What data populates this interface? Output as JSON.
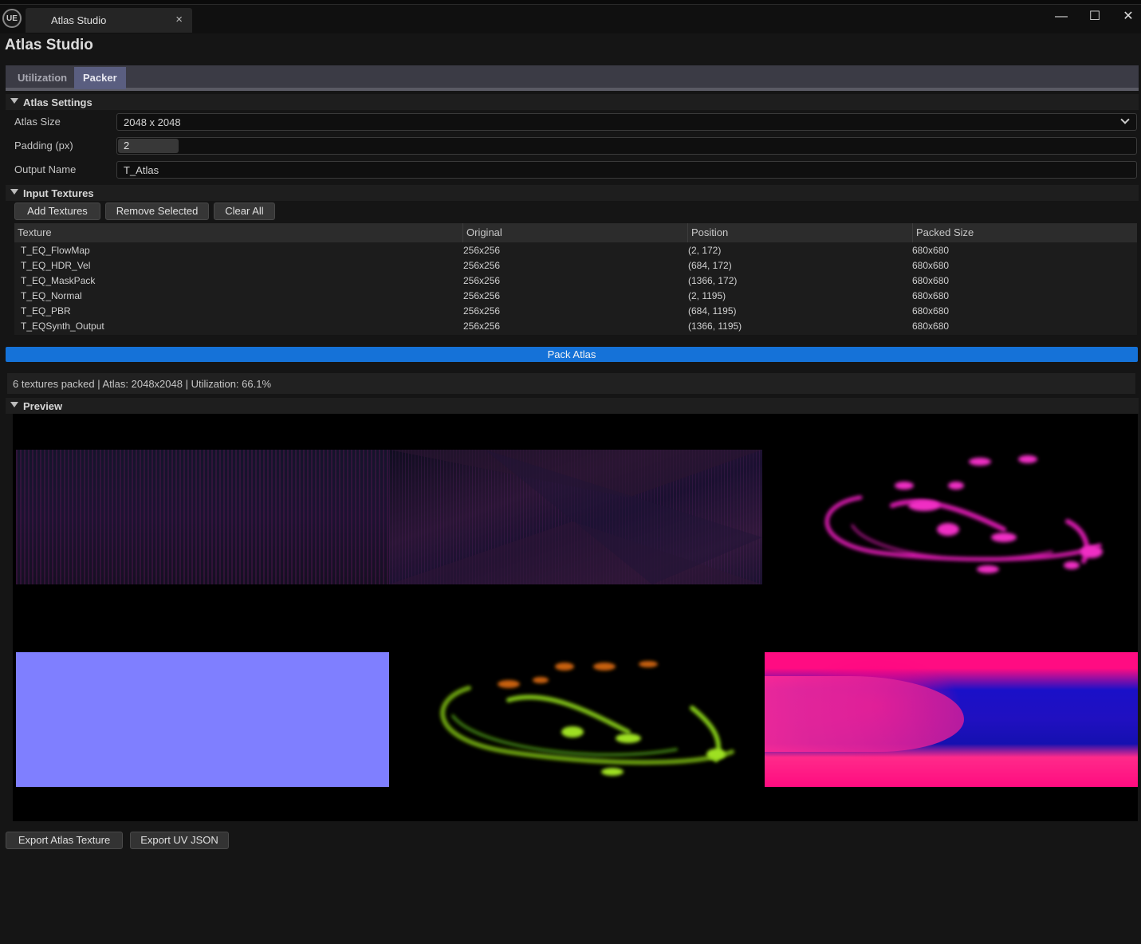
{
  "window": {
    "app_logo": "UE",
    "tab_title": "Atlas Studio",
    "close_tab_glyph": "×",
    "minimize_glyph": "—",
    "maximize_glyph": "☐",
    "close_glyph": "✕"
  },
  "app_title": "Atlas Studio",
  "tabs": [
    {
      "label": "Utilization",
      "active": false
    },
    {
      "label": "Packer",
      "active": true
    }
  ],
  "atlas_settings": {
    "header": "Atlas Settings",
    "atlas_size_label": "Atlas Size",
    "atlas_size_value": "2048 x 2048",
    "padding_label": "Padding (px)",
    "padding_value": "2",
    "output_name_label": "Output Name",
    "output_name_value": "T_Atlas"
  },
  "input_textures": {
    "header": "Input Textures",
    "buttons": {
      "add": "Add Textures",
      "remove": "Remove Selected",
      "clear": "Clear All"
    },
    "columns": [
      "Texture",
      "Original",
      "Position",
      "Packed Size"
    ],
    "rows": [
      {
        "name": "T_EQ_FlowMap",
        "original": "256x256",
        "position": "(2, 172)",
        "packed": "680x680"
      },
      {
        "name": "T_EQ_HDR_Vel",
        "original": "256x256",
        "position": "(684, 172)",
        "packed": "680x680"
      },
      {
        "name": "T_EQ_MaskPack",
        "original": "256x256",
        "position": "(1366, 172)",
        "packed": "680x680"
      },
      {
        "name": "T_EQ_Normal",
        "original": "256x256",
        "position": "(2, 1195)",
        "packed": "680x680"
      },
      {
        "name": "T_EQ_PBR",
        "original": "256x256",
        "position": "(684, 1195)",
        "packed": "680x680"
      },
      {
        "name": "T_EQSynth_Output",
        "original": "256x256",
        "position": "(1366, 1195)",
        "packed": "680x680"
      }
    ]
  },
  "pack_button": "Pack Atlas",
  "status": "6 textures packed | Atlas: 2048x2048 | Utilization: 66.1%",
  "preview": {
    "header": "Preview"
  },
  "footer": {
    "export_texture": "Export Atlas Texture",
    "export_json": "Export UV JSON"
  },
  "colors": {
    "accent": "#1572d8",
    "normal_map": "#7f7fff",
    "tab_active": "#5a5e80"
  }
}
